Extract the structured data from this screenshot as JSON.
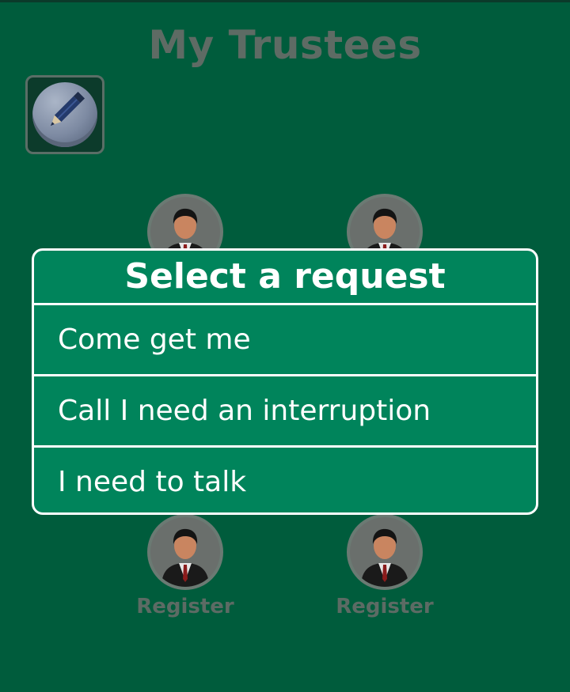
{
  "page": {
    "title": "My Trustees"
  },
  "toolbar": {
    "edit_icon": "pencil-icon"
  },
  "trustees": [
    {
      "avatar_icon": "person-avatar-icon",
      "label": ""
    },
    {
      "avatar_icon": "person-avatar-icon",
      "label": ""
    },
    {
      "avatar_icon": "person-avatar-icon",
      "label": "Register"
    },
    {
      "avatar_icon": "person-avatar-icon",
      "label": "Register"
    }
  ],
  "dialog": {
    "title": "Select a request",
    "options": [
      {
        "label": "Come get me"
      },
      {
        "label": "Call I need an interruption"
      },
      {
        "label": "I need to talk"
      }
    ]
  },
  "colors": {
    "background": "#005c3c",
    "dialog": "#00845b",
    "dialog_border": "#ffffff",
    "dimmed_text": "#5e6b64"
  }
}
